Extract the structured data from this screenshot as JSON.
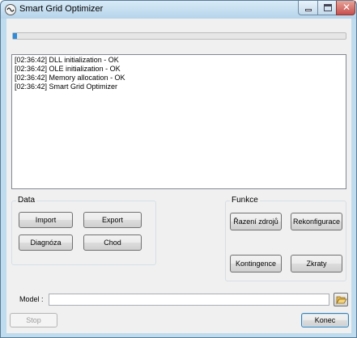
{
  "window": {
    "title": "Smart Grid Optimizer",
    "icons": {
      "app": "app-wave-icon",
      "minimize": "minimize-icon",
      "maximize": "maximize-icon",
      "close": "close-icon"
    },
    "close_glyph": "✕"
  },
  "progress": {
    "value_fraction": 0.01,
    "color": "#2f8bdb"
  },
  "log": {
    "lines": [
      "[02:36:42] DLL initialization  -  OK",
      "[02:36:42] OLE initialization  -  OK",
      "[02:36:42] Memory allocation  -  OK",
      "[02:36:42] Smart Grid Optimizer"
    ]
  },
  "data_group": {
    "legend": "Data",
    "buttons": {
      "import": "Import",
      "export": "Export",
      "diagnoza": "Diagnóza",
      "chod": "Chod"
    }
  },
  "funkce_group": {
    "legend": "Funkce",
    "buttons": {
      "razeni": "Řazení zdrojů",
      "rekonfigurace": "Rekonfigurace",
      "kontingence": "Kontingence",
      "zkraty": "Zkraty"
    }
  },
  "model": {
    "label": "Model :",
    "value": "",
    "browse_icon": "folder-open-icon"
  },
  "footer": {
    "stop": "Stop",
    "konec": "Konec"
  },
  "colors": {
    "title_bar": "#bfdbee",
    "close_button": "#c75050",
    "face": "#f0f0f0"
  }
}
